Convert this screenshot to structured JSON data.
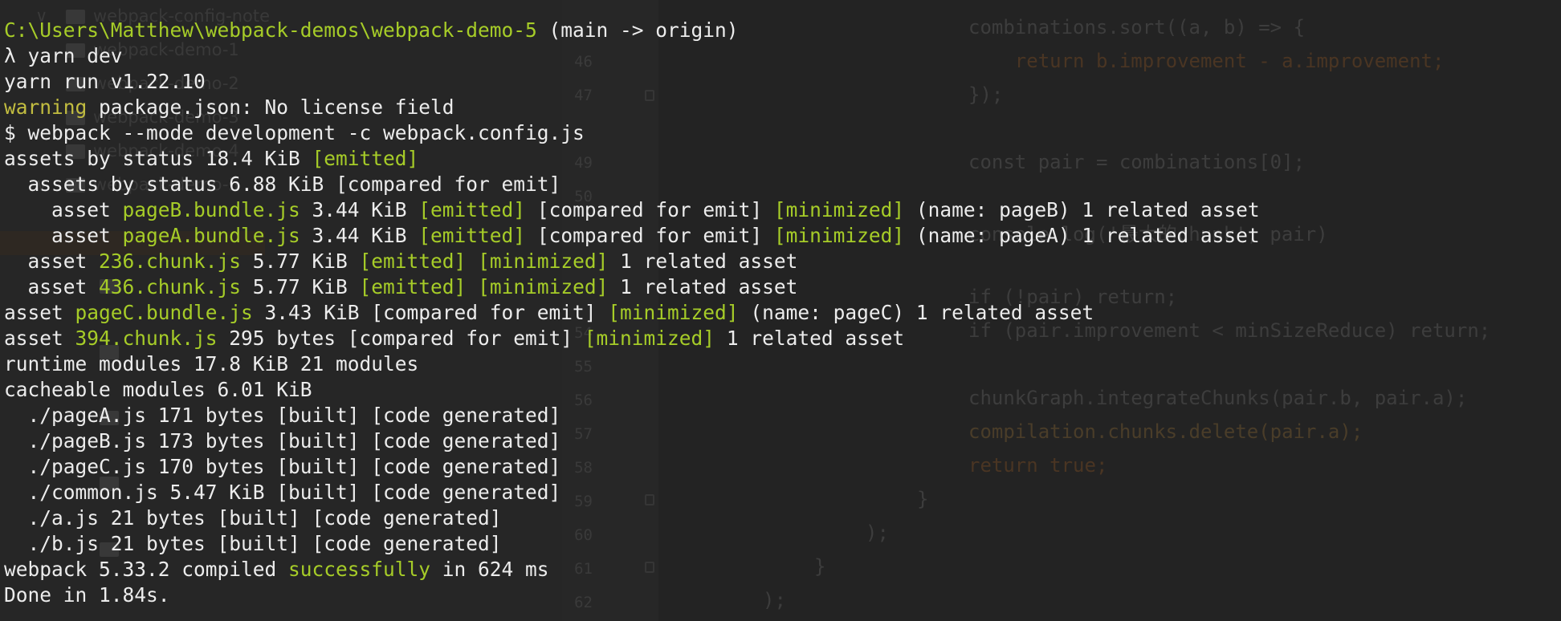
{
  "colors": {
    "default": "#ececec",
    "green": "#a6cc28",
    "yellow": "#c2bd40",
    "background": "#232323"
  },
  "background": {
    "file_tree": [
      {
        "label": "webpack-config-note",
        "expanded": true
      },
      {
        "label": "webpack-demo-1"
      },
      {
        "label": "webpack-demo-2"
      },
      {
        "label": "webpack-demo-3"
      },
      {
        "label": "webpack-demo-4"
      },
      {
        "label": "webpack-demo-5",
        "expanded": true
      }
    ],
    "line_numbers": [
      "46",
      "47",
      "49",
      "50",
      "54",
      "55",
      "56",
      "57",
      "58",
      "59",
      "60",
      "61",
      "62"
    ],
    "code_lines": [
      "combinations.sort((a, b) => {",
      "    return b.improvement - a.improvement;",
      "});",
      "",
      "const pair = combinations[0];",
      "",
      "console.log('最大的chunk', pair)",
      "",
      "if (!pair) return;",
      "if (pair.improvement < minSizeReduce) return;",
      "",
      "chunkGraph.integrateChunks(pair.b, pair.a);",
      "compilation.chunks.delete(pair.a);",
      "return true;",
      "}",
      ");",
      "}",
      ");"
    ]
  },
  "terminal": {
    "lines": [
      [
        {
          "t": "C:\\Users\\Matthew\\webpack-demos\\webpack-demo-5",
          "c": "green"
        },
        {
          "t": " (main -> origin)",
          "c": "white"
        }
      ],
      [
        {
          "t": "λ yarn dev",
          "c": "white"
        }
      ],
      [
        {
          "t": "yarn run v1.22.10",
          "c": "white"
        }
      ],
      [
        {
          "t": "warning",
          "c": "yellow"
        },
        {
          "t": " package.json: No license field",
          "c": "white"
        }
      ],
      [
        {
          "t": "$ webpack --mode development -c webpack.config.js",
          "c": "white"
        }
      ],
      [
        {
          "t": "assets by status 18.4 KiB ",
          "c": "white"
        },
        {
          "t": "[emitted]",
          "c": "green"
        }
      ],
      [
        {
          "t": "  assets by status 6.88 KiB [compared for emit]",
          "c": "white"
        }
      ],
      [
        {
          "t": "    asset ",
          "c": "white"
        },
        {
          "t": "pageB.bundle.js",
          "c": "green"
        },
        {
          "t": " 3.44 KiB ",
          "c": "white"
        },
        {
          "t": "[emitted]",
          "c": "green"
        },
        {
          "t": " [compared for emit] ",
          "c": "white"
        },
        {
          "t": "[minimized]",
          "c": "green"
        },
        {
          "t": " (name: pageB) 1 related asset",
          "c": "white"
        }
      ],
      [
        {
          "t": "    asset ",
          "c": "white"
        },
        {
          "t": "pageA.bundle.js",
          "c": "green"
        },
        {
          "t": " 3.44 KiB ",
          "c": "white"
        },
        {
          "t": "[emitted]",
          "c": "green"
        },
        {
          "t": " [compared for emit] ",
          "c": "white"
        },
        {
          "t": "[minimized]",
          "c": "green"
        },
        {
          "t": " (name: pageA) 1 related asset",
          "c": "white"
        }
      ],
      [
        {
          "t": "  asset ",
          "c": "white"
        },
        {
          "t": "236.chunk.js",
          "c": "green"
        },
        {
          "t": " 5.77 KiB ",
          "c": "white"
        },
        {
          "t": "[emitted]",
          "c": "green"
        },
        {
          "t": " ",
          "c": "white"
        },
        {
          "t": "[minimized]",
          "c": "green"
        },
        {
          "t": " 1 related asset",
          "c": "white"
        }
      ],
      [
        {
          "t": "  asset ",
          "c": "white"
        },
        {
          "t": "436.chunk.js",
          "c": "green"
        },
        {
          "t": " 5.77 KiB ",
          "c": "white"
        },
        {
          "t": "[emitted]",
          "c": "green"
        },
        {
          "t": " ",
          "c": "white"
        },
        {
          "t": "[minimized]",
          "c": "green"
        },
        {
          "t": " 1 related asset",
          "c": "white"
        }
      ],
      [
        {
          "t": "asset ",
          "c": "white"
        },
        {
          "t": "pageC.bundle.js",
          "c": "green"
        },
        {
          "t": " 3.43 KiB [compared for emit] ",
          "c": "white"
        },
        {
          "t": "[minimized]",
          "c": "green"
        },
        {
          "t": " (name: pageC) 1 related asset",
          "c": "white"
        }
      ],
      [
        {
          "t": "asset ",
          "c": "white"
        },
        {
          "t": "394.chunk.js",
          "c": "green"
        },
        {
          "t": " 295 bytes [compared for emit] ",
          "c": "white"
        },
        {
          "t": "[minimized]",
          "c": "green"
        },
        {
          "t": " 1 related asset",
          "c": "white"
        }
      ],
      [
        {
          "t": "runtime modules 17.8 KiB 21 modules",
          "c": "white"
        }
      ],
      [
        {
          "t": "cacheable modules 6.01 KiB",
          "c": "white"
        }
      ],
      [
        {
          "t": "  ./pageA.js 171 bytes [built] [code generated]",
          "c": "white"
        }
      ],
      [
        {
          "t": "  ./pageB.js 173 bytes [built] [code generated]",
          "c": "white"
        }
      ],
      [
        {
          "t": "  ./pageC.js 170 bytes [built] [code generated]",
          "c": "white"
        }
      ],
      [
        {
          "t": "  ./common.js 5.47 KiB [built] [code generated]",
          "c": "white"
        }
      ],
      [
        {
          "t": "  ./a.js 21 bytes [built] [code generated]",
          "c": "white"
        }
      ],
      [
        {
          "t": "  ./b.js 21 bytes [built] [code generated]",
          "c": "white"
        }
      ],
      [
        {
          "t": "webpack 5.33.2 compiled ",
          "c": "white"
        },
        {
          "t": "successfully",
          "c": "green"
        },
        {
          "t": " in 624 ms",
          "c": "white"
        }
      ],
      [
        {
          "t": "Done in 1.84s.",
          "c": "white"
        }
      ]
    ]
  }
}
